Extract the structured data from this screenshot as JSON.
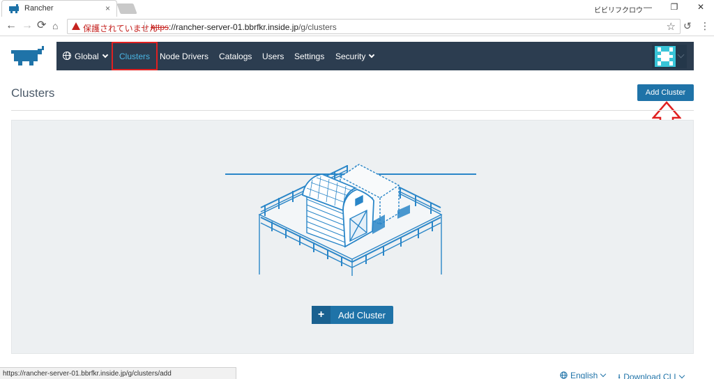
{
  "browser": {
    "tab_title": "Rancher",
    "tab_close": "×",
    "window_user": "ビビリフクロウ",
    "window_controls": {
      "minimize": "—",
      "restore": "❐",
      "close": "✕"
    },
    "security_warning": "保護されていません",
    "url_protocol": "https",
    "url_host": "://rancher-server-01.bbrfkr.inside.jp",
    "url_path": "/g/clusters",
    "status_url": "https://rancher-server-01.bbrfkr.inside.jp/g/clusters/add"
  },
  "nav": {
    "scope": "Global",
    "items": [
      {
        "label": "Clusters",
        "active": true
      },
      {
        "label": "Node Drivers"
      },
      {
        "label": "Catalogs"
      },
      {
        "label": "Users"
      },
      {
        "label": "Settings"
      },
      {
        "label": "Security"
      }
    ]
  },
  "page": {
    "title": "Clusters",
    "add_button": "Add Cluster"
  },
  "empty_state": {
    "add_button": "Add Cluster",
    "plus_icon": "+"
  },
  "footer": {
    "language": "English",
    "download": "Download CLI"
  },
  "colors": {
    "nav_bg": "#2c3d50",
    "accent": "#1f73a8",
    "active_nav": "#4ab5e3",
    "annotation_red": "#e02020"
  }
}
